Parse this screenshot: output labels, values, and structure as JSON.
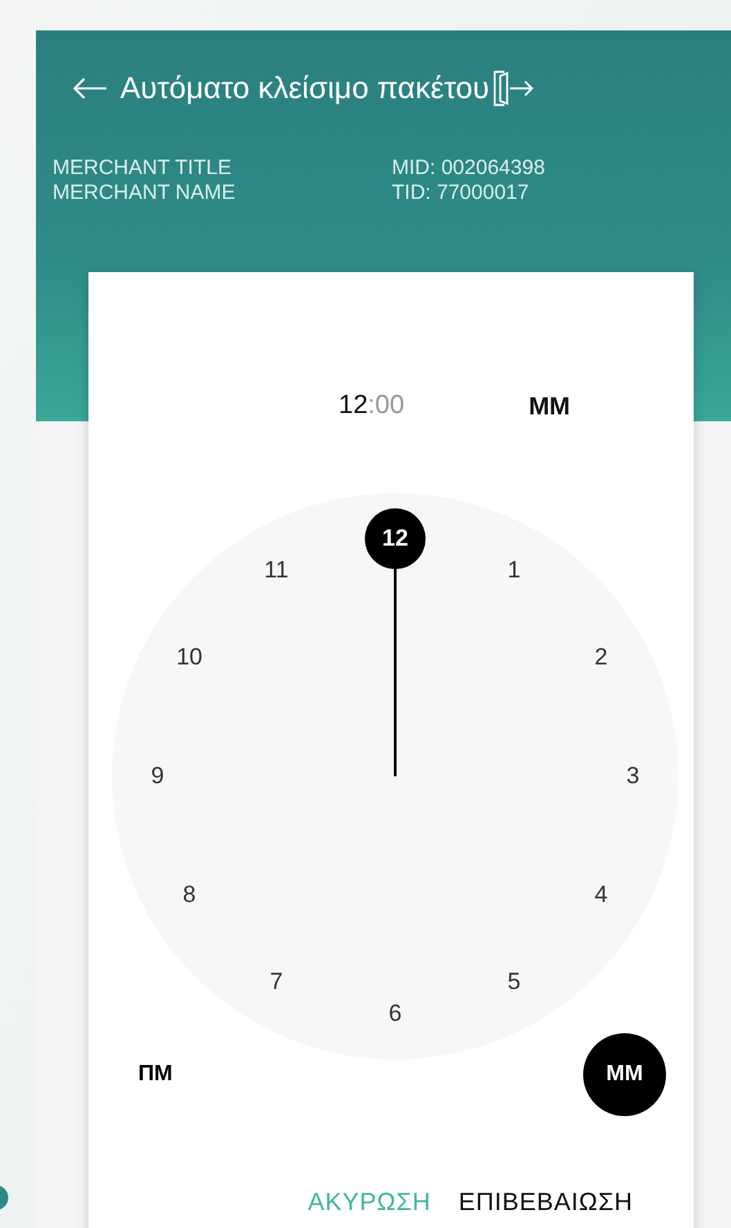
{
  "header": {
    "title": "Αυτόματο κλείσιμο πακέτου"
  },
  "merchant": {
    "title": "MERCHANT TITLE",
    "name": "MERCHANT NAME",
    "mid": "MID: 002064398",
    "tid": "TID: 77000017"
  },
  "time_picker": {
    "hour": "12",
    "minute": ":00",
    "period_label": "MM",
    "dial": [
      {
        "label": "12",
        "selected": true
      },
      {
        "label": "1",
        "selected": false
      },
      {
        "label": "2",
        "selected": false
      },
      {
        "label": "3",
        "selected": false
      },
      {
        "label": "4",
        "selected": false
      },
      {
        "label": "5",
        "selected": false
      },
      {
        "label": "6",
        "selected": false
      },
      {
        "label": "7",
        "selected": false
      },
      {
        "label": "8",
        "selected": false
      },
      {
        "label": "9",
        "selected": false
      },
      {
        "label": "10",
        "selected": false
      },
      {
        "label": "11",
        "selected": false
      }
    ],
    "periods": [
      {
        "label": "ΠΜ",
        "selected": false
      },
      {
        "label": "MM",
        "selected": true
      }
    ],
    "buttons": [
      {
        "label": "ΑΚΥΡΩΣΗ",
        "kind": "cancel"
      },
      {
        "label": "ΕΠΙΒΕΒΑΙΩΣΗ",
        "kind": "confirm"
      }
    ]
  }
}
